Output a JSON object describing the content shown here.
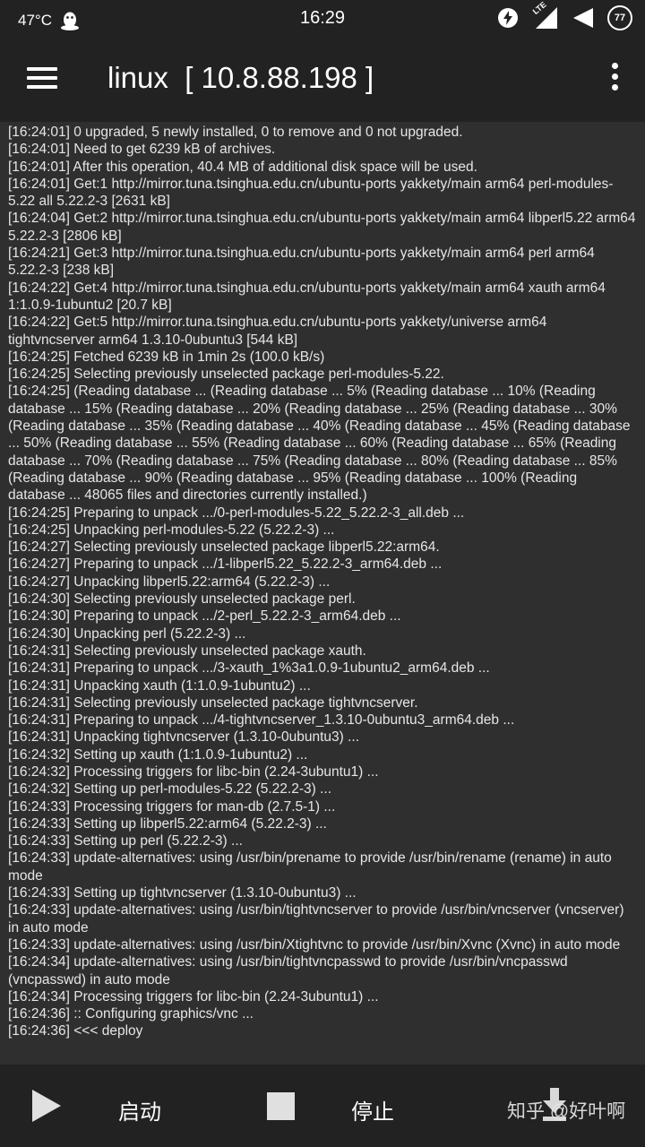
{
  "status_bar": {
    "temperature": "47°C",
    "time": "16:29",
    "network": "LTE",
    "battery": "77",
    "icons": [
      "qq-penguin-icon",
      "data-saver-icon",
      "lte-signal-icon",
      "wifi-signal-icon",
      "battery-icon"
    ]
  },
  "app_bar": {
    "title": "linux  [ 10.8.88.198 ]",
    "menu_icon": "hamburger-menu-icon",
    "overflow_icon": "more-vert-icon"
  },
  "log_lines": [
    "[16:24:01] 0 upgraded, 5 newly installed, 0 to remove and 0 not upgraded.",
    "[16:24:01] Need to get 6239 kB of archives.",
    "[16:24:01] After this operation, 40.4 MB of additional disk space will be used.",
    "[16:24:01] Get:1 http://mirror.tuna.tsinghua.edu.cn/ubuntu-ports yakkety/main arm64 perl-modules-5.22 all 5.22.2-3 [2631 kB]",
    "[16:24:04] Get:2 http://mirror.tuna.tsinghua.edu.cn/ubuntu-ports yakkety/main arm64 libperl5.22 arm64 5.22.2-3 [2806 kB]",
    "[16:24:21] Get:3 http://mirror.tuna.tsinghua.edu.cn/ubuntu-ports yakkety/main arm64 perl arm64 5.22.2-3 [238 kB]",
    "[16:24:22] Get:4 http://mirror.tuna.tsinghua.edu.cn/ubuntu-ports yakkety/main arm64 xauth arm64 1:1.0.9-1ubuntu2 [20.7 kB]",
    "[16:24:22] Get:5 http://mirror.tuna.tsinghua.edu.cn/ubuntu-ports yakkety/universe arm64 tightvncserver arm64 1.3.10-0ubuntu3 [544 kB]",
    "[16:24:25] Fetched 6239 kB in 1min 2s (100.0 kB/s)",
    "[16:24:25] Selecting previously unselected package perl-modules-5.22.",
    "[16:24:25] (Reading database ... (Reading database ... 5% (Reading database ... 10% (Reading database ... 15% (Reading database ... 20% (Reading database ... 25% (Reading database ... 30% (Reading database ... 35% (Reading database ... 40% (Reading database ... 45% (Reading database ... 50% (Reading database ... 55% (Reading database ... 60% (Reading database ... 65% (Reading database ... 70% (Reading database ... 75% (Reading database ... 80% (Reading database ... 85% (Reading database ... 90% (Reading database ... 95% (Reading database ... 100% (Reading database ... 48065 files and directories currently installed.)",
    "[16:24:25] Preparing to unpack .../0-perl-modules-5.22_5.22.2-3_all.deb ...",
    "[16:24:25] Unpacking perl-modules-5.22 (5.22.2-3) ...",
    "[16:24:27] Selecting previously unselected package libperl5.22:arm64.",
    "[16:24:27] Preparing to unpack .../1-libperl5.22_5.22.2-3_arm64.deb ...",
    "[16:24:27] Unpacking libperl5.22:arm64 (5.22.2-3) ...",
    "[16:24:30] Selecting previously unselected package perl.",
    "[16:24:30] Preparing to unpack .../2-perl_5.22.2-3_arm64.deb ...",
    "[16:24:30] Unpacking perl (5.22.2-3) ...",
    "[16:24:31] Selecting previously unselected package xauth.",
    "[16:24:31] Preparing to unpack .../3-xauth_1%3a1.0.9-1ubuntu2_arm64.deb ...",
    "[16:24:31] Unpacking xauth (1:1.0.9-1ubuntu2) ...",
    "[16:24:31] Selecting previously unselected package tightvncserver.",
    "[16:24:31] Preparing to unpack .../4-tightvncserver_1.3.10-0ubuntu3_arm64.deb ...",
    "[16:24:31] Unpacking tightvncserver (1.3.10-0ubuntu3) ...",
    "[16:24:32] Setting up xauth (1:1.0.9-1ubuntu2) ...",
    "[16:24:32] Processing triggers for libc-bin (2.24-3ubuntu1) ...",
    "[16:24:32] Setting up perl-modules-5.22 (5.22.2-3) ...",
    "[16:24:33] Processing triggers for man-db (2.7.5-1) ...",
    "[16:24:33] Setting up libperl5.22:arm64 (5.22.2-3) ...",
    "[16:24:33] Setting up perl (5.22.2-3) ...",
    "[16:24:33] update-alternatives: using /usr/bin/prename to provide /usr/bin/rename (rename) in auto mode",
    "[16:24:33] Setting up tightvncserver (1.3.10-0ubuntu3) ...",
    "[16:24:33] update-alternatives: using /usr/bin/tightvncserver to provide /usr/bin/vncserver (vncserver) in auto mode",
    "[16:24:33] update-alternatives: using /usr/bin/Xtightvnc to provide /usr/bin/Xvnc (Xvnc) in auto mode",
    "[16:24:34] update-alternatives: using /usr/bin/tightvncpasswd to provide /usr/bin/vncpasswd (vncpasswd) in auto mode",
    "[16:24:34] Processing triggers for libc-bin (2.24-3ubuntu1) ...",
    "[16:24:36] :: Configuring graphics/vnc ...",
    "[16:24:36] <<< deploy"
  ],
  "bottom_bar": {
    "start_label": "启动",
    "stop_label": "停止",
    "download_icon": "download-icon",
    "watermark": "知乎 @好叶啊"
  },
  "colors": {
    "bar_background": "#222222",
    "terminal_background": "#2f2f2f",
    "text": "#e6e6e6"
  }
}
